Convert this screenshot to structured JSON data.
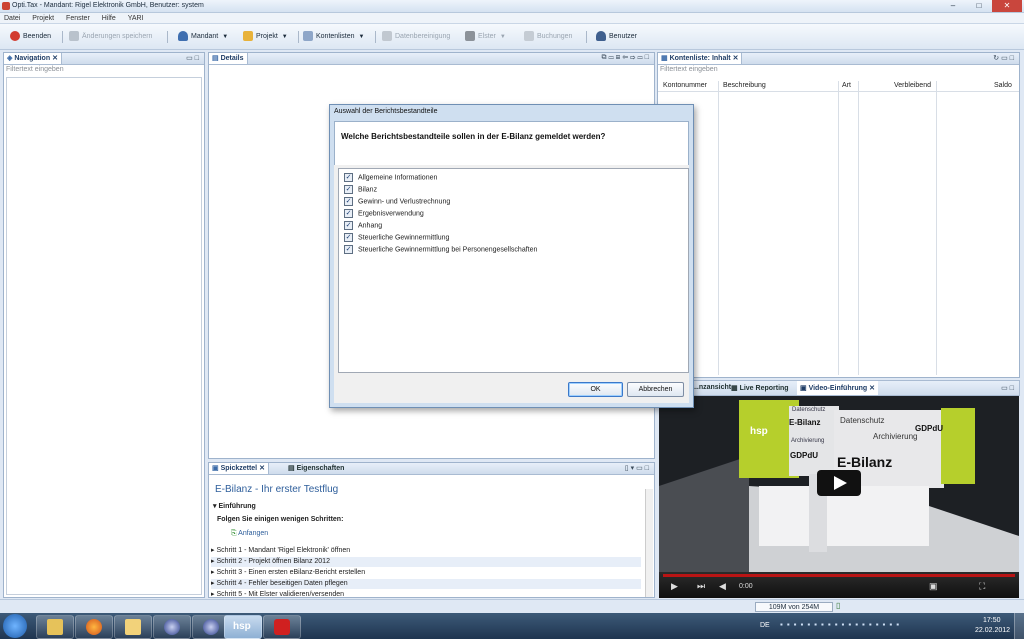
{
  "window": {
    "title": "Opti.Tax - Mandant: Rigel Elektronik GmbH, Benutzer: system",
    "controls": [
      "–",
      "□",
      "✕"
    ]
  },
  "menu": [
    "Datei",
    "Projekt",
    "Fenster",
    "Hilfe",
    "YARI"
  ],
  "toolbar": {
    "beenden": "Beenden",
    "aenderungen": "Änderungen speichern",
    "mandant": "Mandant",
    "projekt": "Projekt",
    "kontenlisten": "Kontenlisten",
    "datenbereinigung": "Datenbereinigung",
    "elster": "Elster",
    "buchungen": "Buchungen",
    "benutzer": "Benutzer"
  },
  "navigation": {
    "tab": "Navigation",
    "filter_placeholder": "Filtertext eingeben"
  },
  "details": {
    "tab": "Details"
  },
  "kontenliste": {
    "tab": "Kontenliste: Inhalt",
    "filter_placeholder": "Filtertext eingeben",
    "columns": [
      "Kontonummer",
      "Beschreibung",
      "Art",
      "Verbleibend",
      "Saldo"
    ]
  },
  "dialog": {
    "title": "Auswahl der Berichtsbestandteile",
    "question": "Welche Berichtsbestandteile sollen in der E-Bilanz gemeldet werden?",
    "items": [
      "Allgemeine Informationen",
      "Bilanz",
      "Gewinn- und Verlustrechnung",
      "Ergebnisverwendung",
      "Anhang",
      "Steuerliche Gewinnermittlung",
      "Steuerliche Gewinnermittlung bei Personengesellschaften"
    ],
    "ok": "OK",
    "cancel": "Abbrechen"
  },
  "spickzettel": {
    "tab": "Spickzettel",
    "tab2": "Eigenschaften",
    "heading": "E-Bilanz - Ihr erster Testflug",
    "section": "Einführung",
    "subhead": "Folgen Sie einigen wenigen Schritten:",
    "start": "Anfangen",
    "steps": [
      "Schritt 1 - Mandant 'Rigel Elektronik' öffnen",
      "Schritt 2 - Projekt öffnen Bilanz 2012",
      "Schritt 3 - Einen ersten eBilanz-Bericht erstellen",
      "Schritt 4 - Fehler beseitigen Daten pflegen",
      "Schritt 5 - Mit Elster validieren/versenden"
    ]
  },
  "bottom_right": {
    "tabs": [
      "...nzansicht",
      "Live Reporting",
      "Video-Einführung"
    ],
    "video_time": "0:00",
    "video_signs": [
      "Datenschutz",
      "E-Bilanz",
      "Archivierung",
      "GDPdU",
      "hsp",
      "Datenschutz",
      "Archivierung",
      "GDPdU",
      "E-Bilanz"
    ]
  },
  "status": {
    "memory": "109M von 254M"
  },
  "taskbar": {
    "lang": "DE",
    "time": "17:50",
    "date": "22.02.2012"
  },
  "colors": {
    "accent": "#2e5e9b",
    "dialog_bg": "#cfdff0"
  }
}
